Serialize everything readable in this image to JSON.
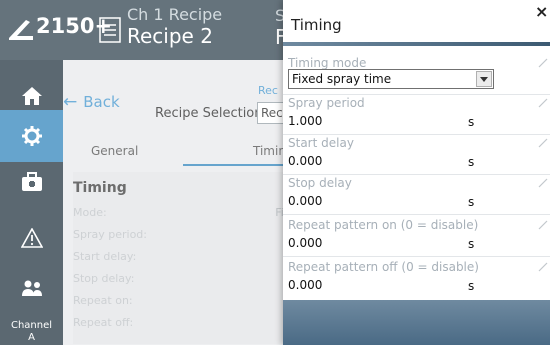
{
  "header": {
    "model": "2150+",
    "channel_recipe": "Ch 1 Recipe",
    "recipe_name": "Recipe 2",
    "peek_right_top": "S",
    "peek_right_bottom": "F"
  },
  "sidebar": {
    "items": [
      {
        "icon": "home-icon",
        "active": false
      },
      {
        "icon": "gear-icon",
        "active": true
      },
      {
        "icon": "toolbox-icon",
        "active": false
      },
      {
        "icon": "warning-icon",
        "active": false
      },
      {
        "icon": "users-icon",
        "active": false
      }
    ],
    "channel_label_top": "Channel",
    "channel_label_bottom": "A"
  },
  "main": {
    "back_label": "Back",
    "rec_partial": "Rec",
    "recipe_selection_label": "Recipe Selection:",
    "recipe_selection_value": "Rec",
    "tabs": [
      {
        "label": "General",
        "active": false
      },
      {
        "label": "Timing",
        "active": true
      }
    ],
    "section_title": "Timing",
    "rows": [
      {
        "label": "Mode:",
        "value": "Fixed s"
      },
      {
        "label": "Spray period:",
        "value": "1."
      },
      {
        "label": "Start delay:",
        "value": "0."
      },
      {
        "label": "Stop delay:",
        "value": "0."
      },
      {
        "label": "Repeat on:",
        "value": "0."
      },
      {
        "label": "Repeat off:",
        "value": "0."
      }
    ]
  },
  "dialog": {
    "title": "Timing",
    "close": "×",
    "fields": [
      {
        "label": "Timing mode",
        "value": "Fixed spray time",
        "unit": "",
        "type": "select"
      },
      {
        "label": "Spray period",
        "value": "1.000",
        "unit": "s",
        "type": "number"
      },
      {
        "label": "Start delay",
        "value": "0.000",
        "unit": "s",
        "type": "number"
      },
      {
        "label": "Stop delay",
        "value": "0.000",
        "unit": "s",
        "type": "number"
      },
      {
        "label": "Repeat pattern on (0 = disable)",
        "value": "0.000",
        "unit": "s",
        "type": "number"
      },
      {
        "label": "Repeat pattern off (0 = disable)",
        "value": "0.000",
        "unit": "s",
        "type": "number"
      }
    ]
  },
  "colors": {
    "header_bg": "#3a4c58",
    "sidebar_bg": "#2d3e49",
    "accent": "#3b8bbf",
    "link": "#4a9ad0"
  }
}
